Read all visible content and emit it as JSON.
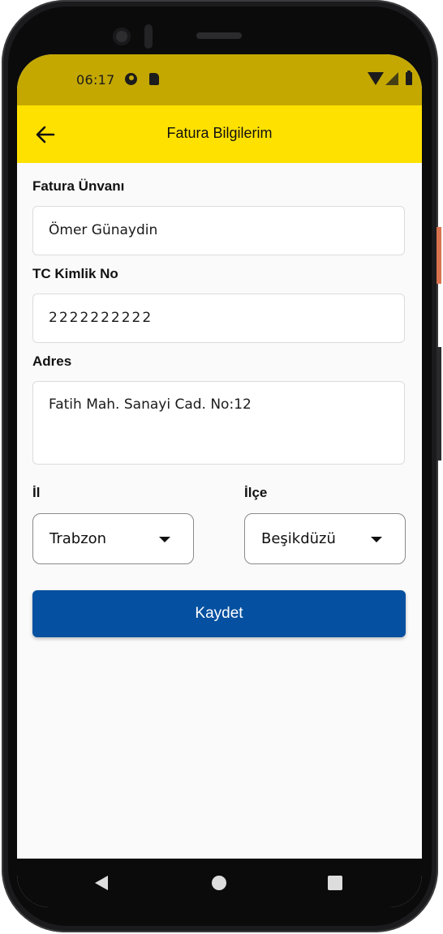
{
  "status_bar": {
    "time": "06:17",
    "icons": [
      "app-notification-icon",
      "sd-card-icon",
      "wifi-icon",
      "signal-icon",
      "battery-icon"
    ]
  },
  "app_bar": {
    "title": "Fatura Bilgilerim",
    "back_icon": "arrow-left-icon"
  },
  "form": {
    "title_label": "Fatura Ünvanı",
    "title_value": "Ömer Günaydin",
    "tc_label": "TC Kimlik No",
    "tc_value": "2222222222",
    "address_label": "Adres",
    "address_value": "Fatih Mah. Sanayi Cad. No:12",
    "city_label": "İl",
    "city_value": "Trabzon",
    "district_label": "İlçe",
    "district_value": "Beşikdüzü"
  },
  "actions": {
    "save_label": "Kaydet"
  },
  "nav_bar": {
    "icons": [
      "back-triangle-icon",
      "home-circle-icon",
      "recents-square-icon"
    ]
  },
  "colors": {
    "status_bar": "#c4a800",
    "app_bar": "#ffe100",
    "primary_button": "#0550a0",
    "background": "#fafafa"
  }
}
